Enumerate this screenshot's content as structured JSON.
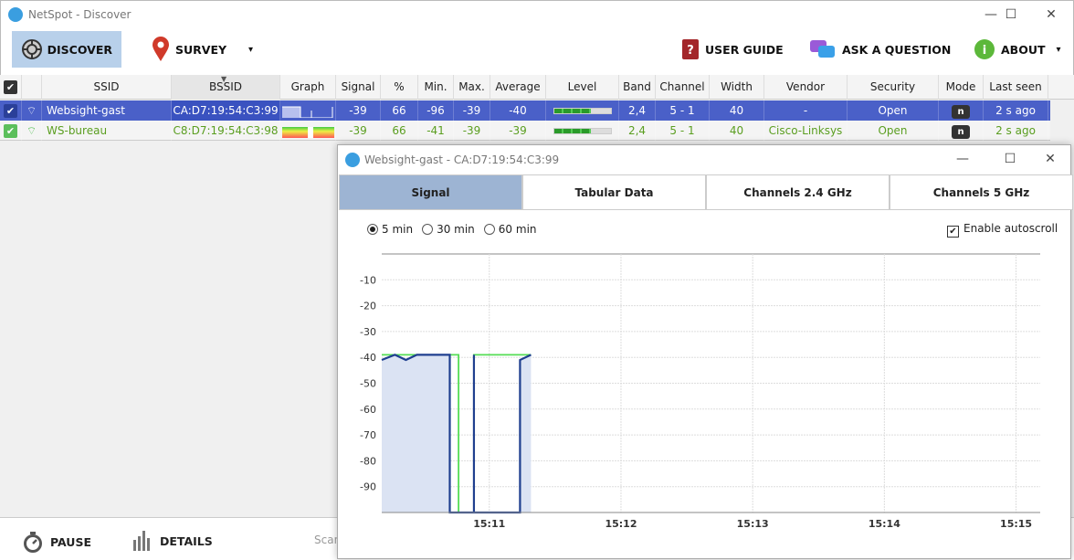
{
  "window": {
    "title": "NetSpot - Discover",
    "minimize": "—",
    "maximize": "☐",
    "close": "✕"
  },
  "toolbar": {
    "discover": "DISCOVER",
    "survey": "SURVEY",
    "survey_dropdown": "▾",
    "user_guide": "USER GUIDE",
    "ask": "ASK A QUESTION",
    "about": "ABOUT",
    "about_dropdown": "▾"
  },
  "table": {
    "columns": [
      "SSID",
      "BSSID",
      "Graph",
      "Signal",
      "%",
      "Min.",
      "Max.",
      "Average",
      "Level",
      "Band",
      "Channel",
      "Width",
      "Vendor",
      "Security",
      "Mode",
      "Last seen"
    ],
    "sort_indicator": "▼",
    "rows": [
      {
        "checked": true,
        "ssid": "Websight-gast",
        "bssid": "CA:D7:19:54:C3:99",
        "signal": "-39",
        "percent": "66",
        "min": "-96",
        "max": "-39",
        "average": "-40",
        "level_percent": 66,
        "band": "2,4",
        "channel": "5 - 1",
        "width": "40",
        "vendor": "-",
        "security": "Open",
        "mode": "n",
        "last_seen": "2 s ago",
        "selected": true
      },
      {
        "checked": true,
        "ssid": "WS-bureau",
        "bssid": "C8:D7:19:54:C3:98",
        "signal": "-39",
        "percent": "66",
        "min": "-41",
        "max": "-39",
        "average": "-39",
        "level_percent": 66,
        "band": "2,4",
        "channel": "5 - 1",
        "width": "40",
        "vendor": "Cisco-Linksys",
        "security": "Open",
        "mode": "n",
        "last_seen": "2 s ago",
        "selected": false
      }
    ]
  },
  "bottom": {
    "pause": "PAUSE",
    "details": "DETAILS",
    "scan": "Scan"
  },
  "child": {
    "title": "Websight-gast - CA:D7:19:54:C3:99",
    "tabs": [
      "Signal",
      "Tabular Data",
      "Channels 2.4 GHz",
      "Channels 5 GHz"
    ],
    "active_tab": 0,
    "ranges": [
      "5 min",
      "30 min",
      "60 min"
    ],
    "selected_range": 0,
    "autoscroll_label": "Enable autoscroll",
    "autoscroll": true
  },
  "colors": {
    "selected_row": "#4a60c8",
    "green_text": "#5a9e20",
    "blue_series": "#1f3f8f",
    "green_series": "#55dd55"
  },
  "chart_data": {
    "type": "line",
    "ylim": [
      -100,
      0
    ],
    "yticks": [
      -10,
      -20,
      -30,
      -40,
      -50,
      -60,
      -70,
      -80,
      -90
    ],
    "xlim": [
      "15:10:11",
      "15:15:11"
    ],
    "xticks": [
      "15:11",
      "15:12",
      "15:13",
      "15:14",
      "15:15"
    ],
    "grid": true,
    "series": [
      {
        "color": "#1f3f8f",
        "fill": true,
        "points": [
          [
            "15:10:11",
            -41
          ],
          [
            "15:10:17",
            -39
          ],
          [
            "15:10:22",
            -41
          ],
          [
            "15:10:27",
            -39
          ],
          [
            "15:10:42",
            -39
          ],
          [
            "15:10:42",
            -100
          ],
          [
            "15:10:53",
            -100
          ],
          [
            "15:10:53",
            -39
          ],
          [
            "15:10:53",
            -100
          ],
          [
            "15:11:14",
            -100
          ],
          [
            "15:11:14",
            -41
          ],
          [
            "15:11:19",
            -39
          ]
        ]
      },
      {
        "color": "#55dd55",
        "fill": false,
        "points": [
          [
            "15:10:11",
            -39
          ],
          [
            "15:10:46",
            -39
          ],
          [
            "15:10:46",
            -100
          ],
          [
            "15:10:53",
            -100
          ],
          [
            "15:10:53",
            -39
          ],
          [
            "15:11:19",
            -39
          ]
        ]
      }
    ]
  }
}
